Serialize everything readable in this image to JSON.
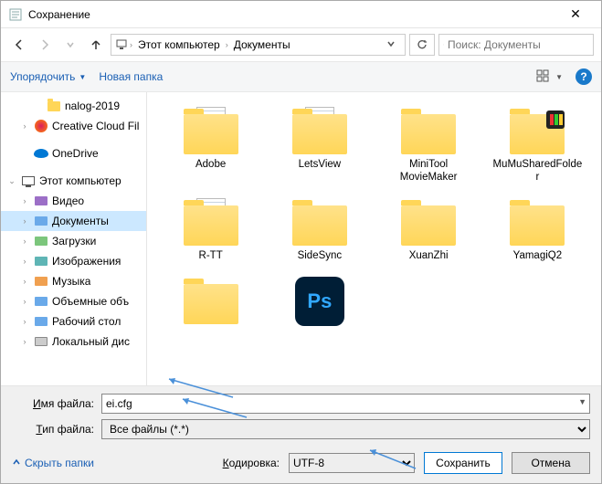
{
  "window": {
    "title": "Сохранение",
    "close": "✕"
  },
  "nav": {
    "breadcrumb": {
      "root_icon": "🖥",
      "loc1": "Этот компьютер",
      "loc2": "Документы"
    },
    "search_placeholder": "Поиск: Документы"
  },
  "toolbar": {
    "organize": "Упорядочить",
    "new_folder": "Новая папка",
    "help": "?"
  },
  "sidebar": {
    "items": [
      {
        "label": "nalog-2019",
        "icon": "folder",
        "depth": 1,
        "chev": ""
      },
      {
        "label": "Creative Cloud Fil",
        "icon": "cc",
        "depth": 0,
        "chev": "›"
      },
      {
        "label": "OneDrive",
        "icon": "onedrive",
        "depth": 0,
        "chev": ""
      },
      {
        "label": "Этот компьютер",
        "icon": "pc",
        "depth": -1,
        "chev": "⌄"
      },
      {
        "label": "Видео",
        "icon": "lib",
        "color": "purple",
        "depth": 0,
        "chev": "›"
      },
      {
        "label": "Документы",
        "icon": "lib",
        "color": "",
        "depth": 0,
        "chev": "›",
        "selected": true
      },
      {
        "label": "Загрузки",
        "icon": "lib",
        "color": "green",
        "depth": 0,
        "chev": "›"
      },
      {
        "label": "Изображения",
        "icon": "lib",
        "color": "teal",
        "depth": 0,
        "chev": "›"
      },
      {
        "label": "Музыка",
        "icon": "lib",
        "color": "orange",
        "depth": 0,
        "chev": "›"
      },
      {
        "label": "Объемные объ",
        "icon": "lib",
        "color": "",
        "depth": 0,
        "chev": "›"
      },
      {
        "label": "Рабочий стол",
        "icon": "lib",
        "color": "",
        "depth": 0,
        "chev": "›"
      },
      {
        "label": "Локальный дис",
        "icon": "drive",
        "depth": 0,
        "chev": "›"
      }
    ]
  },
  "main": {
    "items": [
      {
        "label": "Adobe",
        "type": "folder-doc"
      },
      {
        "label": "LetsView",
        "type": "folder-doc"
      },
      {
        "label": "MiniTool MovieMaker",
        "type": "folder"
      },
      {
        "label": "MuMuSharedFolder",
        "type": "folder-overlay"
      },
      {
        "label": "R-TT",
        "type": "folder-doc"
      },
      {
        "label": "SideSync",
        "type": "folder"
      },
      {
        "label": "XuanZhi",
        "type": "folder"
      },
      {
        "label": "YamagiQ2",
        "type": "folder"
      },
      {
        "label": "",
        "type": "folder"
      },
      {
        "label": "",
        "type": "ps"
      }
    ]
  },
  "form": {
    "filename_label": "Имя файла:",
    "filename_value": "ei.cfg",
    "filetype_label": "Тип файла:",
    "filetype_value": "Все файлы  (*.*)"
  },
  "footer": {
    "hide_folders": "Скрыть папки",
    "encoding_label": "Кодировка:",
    "encoding_value": "UTF-8",
    "save": "Сохранить",
    "cancel": "Отмена"
  }
}
